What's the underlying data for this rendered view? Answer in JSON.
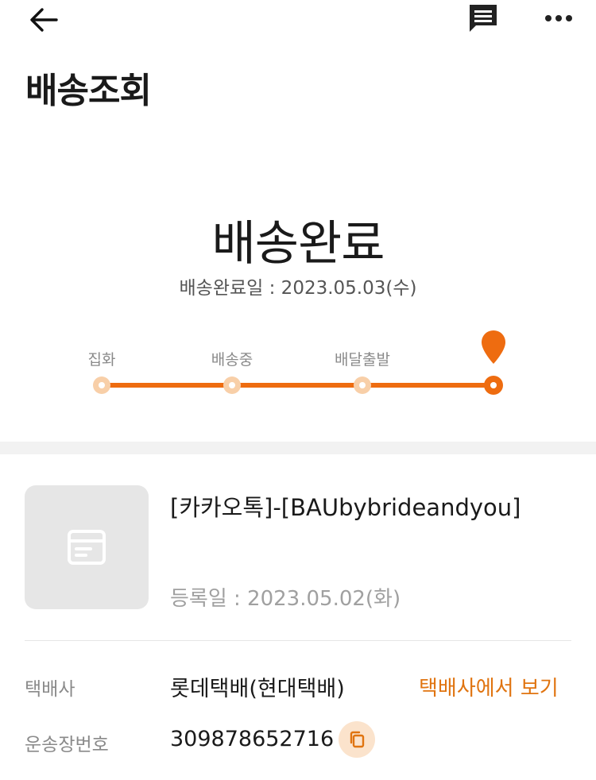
{
  "header": {
    "back_icon": "arrow-left-icon",
    "chat_icon": "chat-bubble-icon",
    "more_icon": "more-horizontal-icon"
  },
  "page_title": "배송조회",
  "status": {
    "title": "배송완료",
    "date_text": "배송완료일 : 2023.05.03(수)"
  },
  "tracker": {
    "steps": [
      {
        "label": "집화"
      },
      {
        "label": "배송중"
      },
      {
        "label": "배달출발"
      },
      {
        "label": ""
      }
    ],
    "current_step": 4,
    "accent_color": "#ee6c10",
    "inactive_dot_color": "#f8cfa8",
    "pin_icon": "location-pin-icon"
  },
  "product": {
    "thumb_icon": "package-icon",
    "name": "[카카오톡]-[BAUbybrideandyou]",
    "registered_text": "등록일 : 2023.05.02(화)"
  },
  "details": {
    "courier_label": "택배사",
    "courier_value": "롯데택배(현대택배)",
    "courier_link": "택배사에서 보기",
    "tracking_label": "운송장번호",
    "tracking_value": "309878652716",
    "copy_icon": "copy-icon"
  },
  "colors": {
    "accent": "#ee6c10",
    "link": "#e07410",
    "copy_bg": "#fbe3cc"
  }
}
